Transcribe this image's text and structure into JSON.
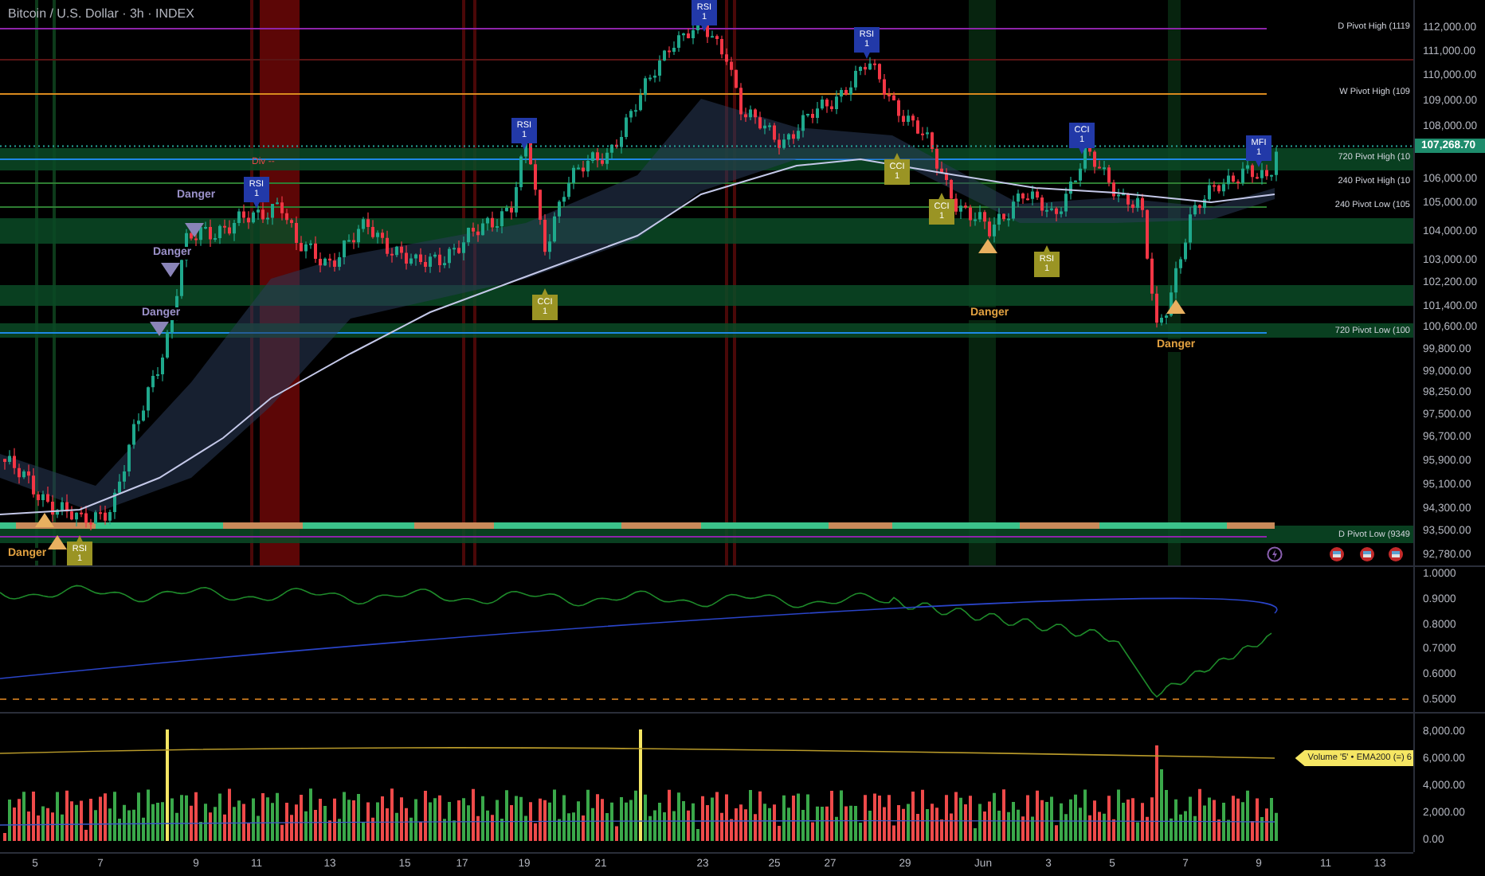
{
  "title": "Bitcoin / U.S. Dollar · 3h · INDEX",
  "price_axis": {
    "ticks": [
      "112,000.00",
      "111,000.00",
      "110,000.00",
      "109,000.00",
      "108,000.00",
      "106,000.00",
      "105,000.00",
      "104,000.00",
      "103,000.00",
      "102,200.00",
      "101,400.00",
      "100,600.00",
      "99,800.00",
      "99,000.00",
      "98,250.00",
      "97,500.00",
      "96,700.00",
      "95,900.00",
      "95,100.00",
      "94,300.00",
      "93,500.00",
      "92,780.00"
    ],
    "last_price": "107,268.70"
  },
  "pivot_levels": [
    {
      "label": "D Pivot High (1119",
      "color": "#8e24aa"
    },
    {
      "label": "W Pivot High (109",
      "color": "#d98a1e"
    },
    {
      "label": "720 Pivot High (10",
      "color": "#1e88e5"
    },
    {
      "label": "240 Pivot High (10",
      "color": "#2e7d32"
    },
    {
      "label": "240 Pivot Low (105",
      "color": "#2e7d32"
    },
    {
      "label": "720 Pivot Low (100",
      "color": "#1e88e5"
    },
    {
      "label": "D Pivot Low (9349",
      "color": "#8e24aa"
    }
  ],
  "signals": [
    {
      "label": "RSI",
      "value": "1",
      "kind": "down",
      "color": "#2239a8"
    },
    {
      "label": "RSI",
      "value": "1",
      "kind": "down",
      "color": "#2239a8"
    },
    {
      "label": "RSI",
      "value": "1",
      "kind": "down",
      "color": "#2239a8"
    },
    {
      "label": "CCI",
      "value": "1",
      "kind": "down",
      "color": "#2239a8"
    },
    {
      "label": "MFI",
      "value": "1",
      "kind": "down",
      "color": "#2239a8"
    },
    {
      "label": "CCI",
      "value": "1",
      "kind": "up",
      "color": "#9a9424"
    },
    {
      "label": "RSI",
      "value": "1",
      "kind": "down",
      "color": "#2239a8"
    },
    {
      "label": "CCI",
      "value": "1",
      "kind": "up",
      "color": "#9a9424"
    },
    {
      "label": "RSI",
      "value": "1",
      "kind": "up",
      "color": "#9a9424"
    },
    {
      "label": "CCI",
      "value": "1",
      "kind": "up",
      "color": "#9a9424"
    },
    {
      "label": "RSI",
      "value": "1",
      "kind": "up",
      "color": "#9a9424"
    }
  ],
  "danger_labels": [
    {
      "text": "Danger",
      "color": "#9a90c8"
    },
    {
      "text": "Danger",
      "color": "#9a90c8"
    },
    {
      "text": "Danger",
      "color": "#9a90c8"
    },
    {
      "text": "Danger",
      "color": "#e0a040"
    },
    {
      "text": "Danger",
      "color": "#e0a040"
    },
    {
      "text": "Danger",
      "color": "#e0a040"
    }
  ],
  "divergence_label": "Div --",
  "oscillator_axis": [
    "1.0000",
    "0.9000",
    "0.8000",
    "0.7000",
    "0.6000",
    "0.5000"
  ],
  "volume_axis": {
    "ticks": [
      "8,000.00",
      "6,000.00",
      "4,000.00",
      "2,000.00",
      "0.00"
    ],
    "legend": "Volume '5' • EMA200 (=) 6"
  },
  "time_axis": [
    "5",
    "7",
    "9",
    "11",
    "13",
    "15",
    "17",
    "19",
    "21",
    "23",
    "25",
    "27",
    "29",
    "Jun",
    "3",
    "5",
    "7",
    "9",
    "11",
    "13"
  ]
}
